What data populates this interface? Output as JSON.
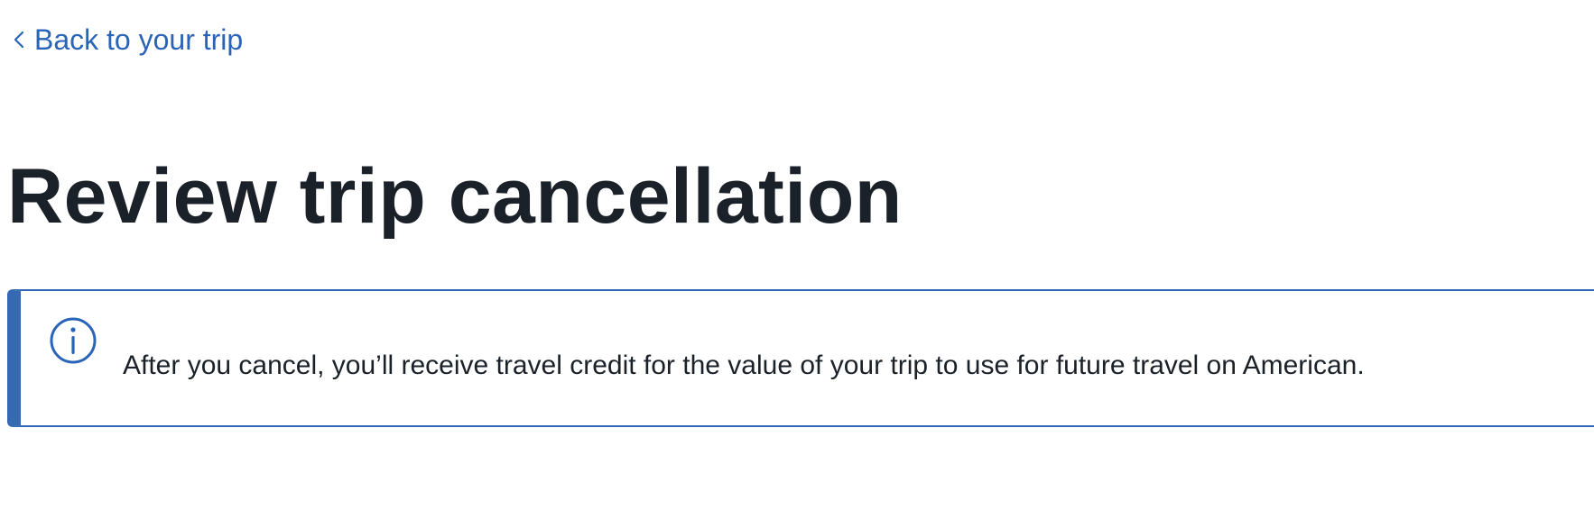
{
  "nav": {
    "back_label": "Back to your trip",
    "back_icon": "chevron-left-icon"
  },
  "header": {
    "title": "Review trip cancellation"
  },
  "notice": {
    "icon": "info-icon",
    "message": "After you cancel, you’ll receive travel credit for the value of your trip to use for future travel on American."
  },
  "colors": {
    "link": "#2a64b9",
    "title": "#1b2128",
    "banner_accent": "#3668b3",
    "banner_border": "#2e67b5"
  }
}
